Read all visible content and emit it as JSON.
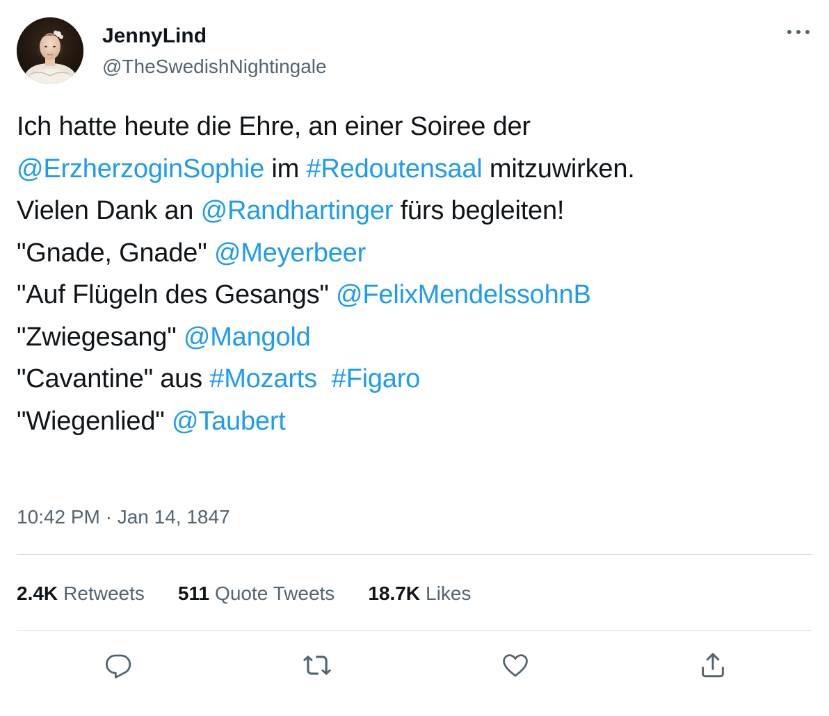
{
  "author": {
    "display_name": "JennyLind",
    "handle": "@TheSwedishNightingale"
  },
  "tweet": {
    "lines": [
      [
        {
          "text": "Ich hatte heute die Ehre, an einer Soiree der",
          "link": false
        }
      ],
      [
        {
          "text": "@ErzherzoginSophie",
          "link": true
        },
        {
          "text": " im ",
          "link": false
        },
        {
          "text": "#Redoutensaal",
          "link": true
        },
        {
          "text": " mitzuwirken.",
          "link": false
        }
      ],
      [
        {
          "text": "Vielen Dank an ",
          "link": false
        },
        {
          "text": "@Randhartinger",
          "link": true
        },
        {
          "text": " fürs begleiten!",
          "link": false
        }
      ],
      [
        {
          "text": "\"Gnade, Gnade\" ",
          "link": false
        },
        {
          "text": "@Meyerbeer",
          "link": true
        }
      ],
      [
        {
          "text": "\"Auf Flügeln des Gesangs\" ",
          "link": false
        },
        {
          "text": "@FelixMendelssohnB",
          "link": true
        }
      ],
      [
        {
          "text": "\"Zwiegesang\" ",
          "link": false
        },
        {
          "text": "@Mangold",
          "link": true
        }
      ],
      [
        {
          "text": "\"Cavantine\" aus ",
          "link": false
        },
        {
          "text": "#Mozarts",
          "link": true
        },
        {
          "text": "  ",
          "link": false
        },
        {
          "text": "#Figaro",
          "link": true
        }
      ],
      [
        {
          "text": "\"Wiegenlied\" ",
          "link": false
        },
        {
          "text": "@Taubert",
          "link": true
        }
      ]
    ],
    "timestamp": "10:42 PM · Jan 14, 1847"
  },
  "stats": [
    {
      "count": "2.4K",
      "label": "Retweets"
    },
    {
      "count": "511",
      "label": "Quote Tweets"
    },
    {
      "count": "18.7K",
      "label": "Likes"
    }
  ],
  "actions": [
    {
      "name": "reply",
      "icon": "reply-icon"
    },
    {
      "name": "retweet",
      "icon": "retweet-icon"
    },
    {
      "name": "like",
      "icon": "heart-icon"
    },
    {
      "name": "share",
      "icon": "share-icon"
    }
  ],
  "more_icon": "more-horizontal-icon",
  "colors": {
    "link": "#1d9bf0",
    "text": "#0f1419",
    "secondary": "#536471",
    "divider": "#cfd9de"
  }
}
